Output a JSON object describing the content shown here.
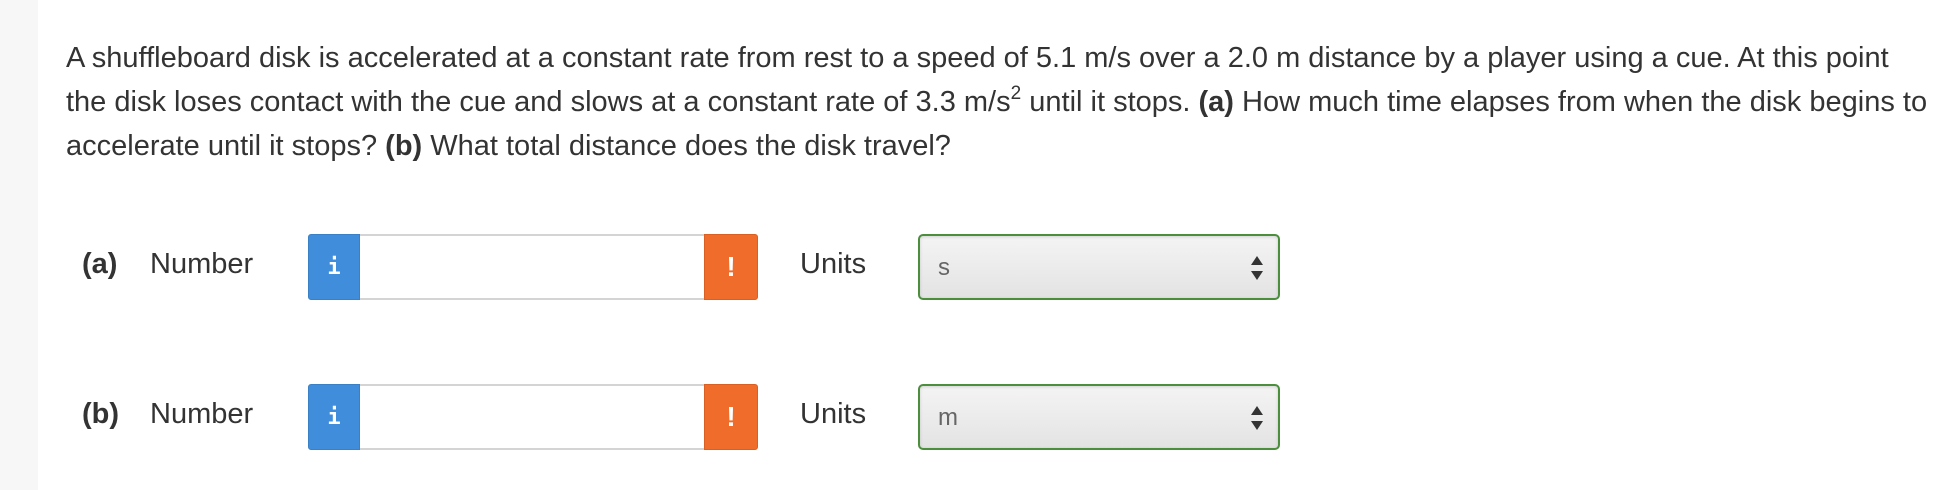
{
  "question": {
    "text_1": "A shuffleboard disk is accelerated at a constant rate from rest to a speed of 5.1 m/s over a 2.0 m distance by a player using a cue. At this point the disk loses contact with the cue and slows at a constant rate of 3.3 m/s",
    "superscript": "2",
    "text_2": " until it stops. ",
    "part_a_marker": "(a)",
    "text_3": " How much time elapses from when the disk begins to accelerate until it stops? ",
    "part_b_marker": "(b)",
    "text_4": " What total distance does the disk travel?"
  },
  "answers": [
    {
      "part_label": "(a)",
      "number_label": "Number",
      "info_icon": "i",
      "number_value": "",
      "warning_icon": "!",
      "units_label": "Units",
      "units_value": "s"
    },
    {
      "part_label": "(b)",
      "number_label": "Number",
      "info_icon": "i",
      "number_value": "",
      "warning_icon": "!",
      "units_label": "Units",
      "units_value": "m"
    }
  ],
  "colors": {
    "info_button": "#3f8ddb",
    "warning_button": "#ef6c2b",
    "select_border": "#4b8f3d"
  },
  "icons": {
    "info": "info-icon",
    "warning": "exclamation-icon",
    "select_arrows": "up-down-arrows-icon"
  }
}
